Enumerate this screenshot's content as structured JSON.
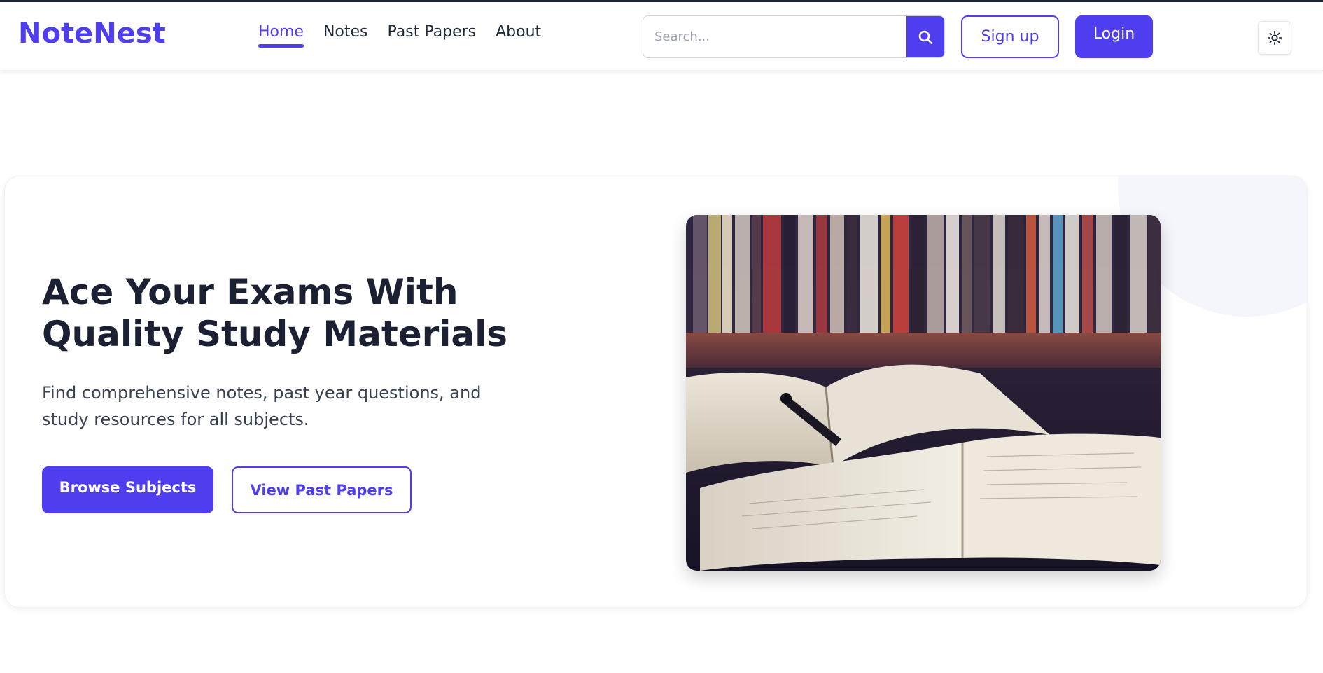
{
  "brand": {
    "name": "NoteNest"
  },
  "nav": {
    "links": [
      {
        "label": "Home",
        "active": true
      },
      {
        "label": "Notes",
        "active": false
      },
      {
        "label": "Past Papers",
        "active": false
      },
      {
        "label": "About",
        "active": false
      }
    ]
  },
  "search": {
    "placeholder": "Search...",
    "value": "",
    "icon": "search-icon"
  },
  "auth": {
    "signup_label": "Sign up",
    "login_label": "Login"
  },
  "theme_toggle": {
    "icon": "sun-icon"
  },
  "hero": {
    "title": "Ace Your Exams With Quality Study Materials",
    "subtitle": "Find comprehensive notes, past year questions, and study resources for all subjects.",
    "primary_label": "Browse Subjects",
    "secondary_label": "View Past Papers"
  },
  "colors": {
    "accent": "#4f3df0",
    "text_dark": "#1b2132",
    "text_body": "#374151"
  }
}
